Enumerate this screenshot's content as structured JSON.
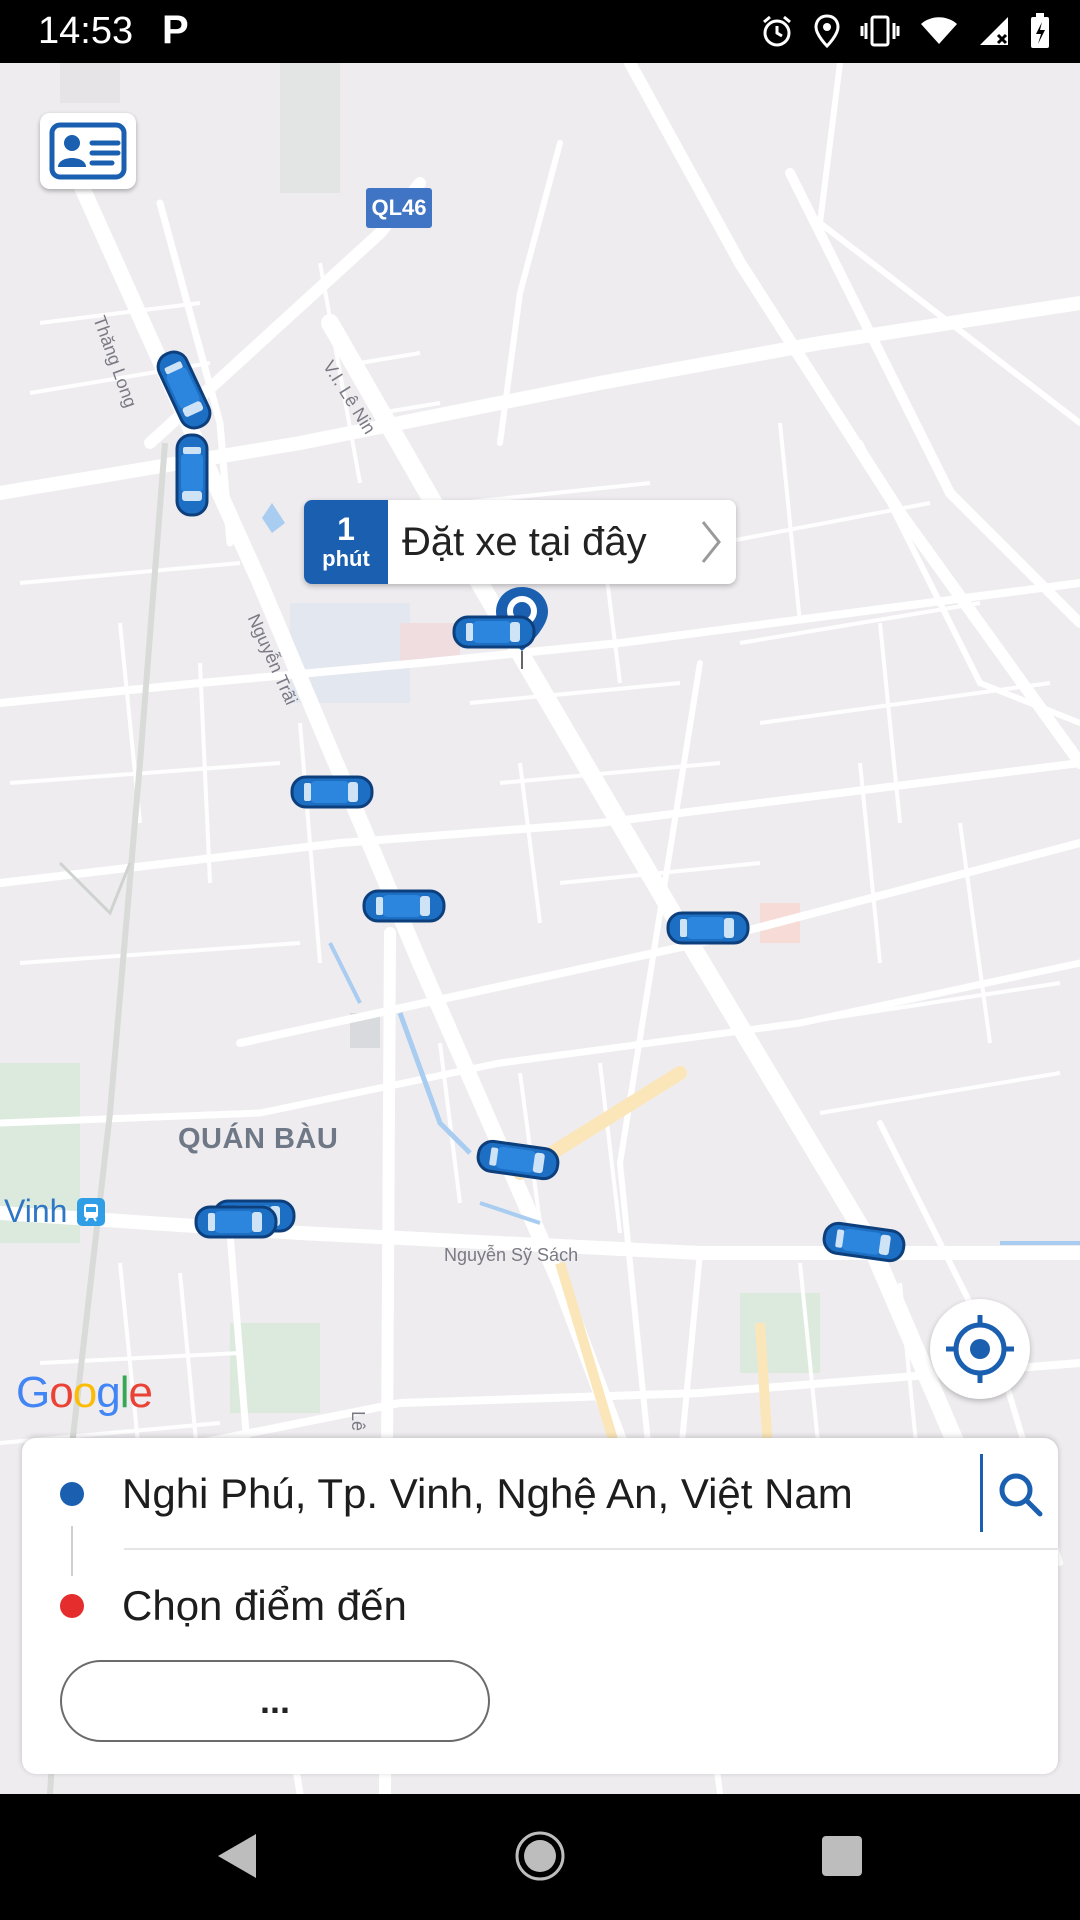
{
  "status_bar": {
    "time": "14:53",
    "app_indicator": "P",
    "icons": [
      "alarm-icon",
      "location-icon",
      "vibrate-icon",
      "wifi-icon",
      "signal-icon",
      "battery-icon"
    ]
  },
  "map": {
    "route_shield": "QL46",
    "street_labels": {
      "thang_long": "Thăng Long",
      "vi_le_nin": "V.I. Lê Nin",
      "nguyen_trai": "Nguyễn Trãi",
      "nguyen_sy_sach": "Nguyễn Sỹ Sách",
      "le": "Lê"
    },
    "district": "QUÁN BÀU",
    "station": "Vinh",
    "attribution": "Google",
    "pickup": {
      "eta_value": "1",
      "eta_unit": "phút",
      "label": "Đặt xe tại đây"
    }
  },
  "trip": {
    "origin": "Nghi Phú, Tp. Vinh, Nghệ An, Việt Nam",
    "destination_placeholder": "Chọn điểm đến",
    "more_label": "..."
  },
  "colors": {
    "brand": "#1b5fb0",
    "origin_dot": "#1b5fb0",
    "destination_dot": "#e52d2d",
    "map_background": "#eeecef"
  }
}
